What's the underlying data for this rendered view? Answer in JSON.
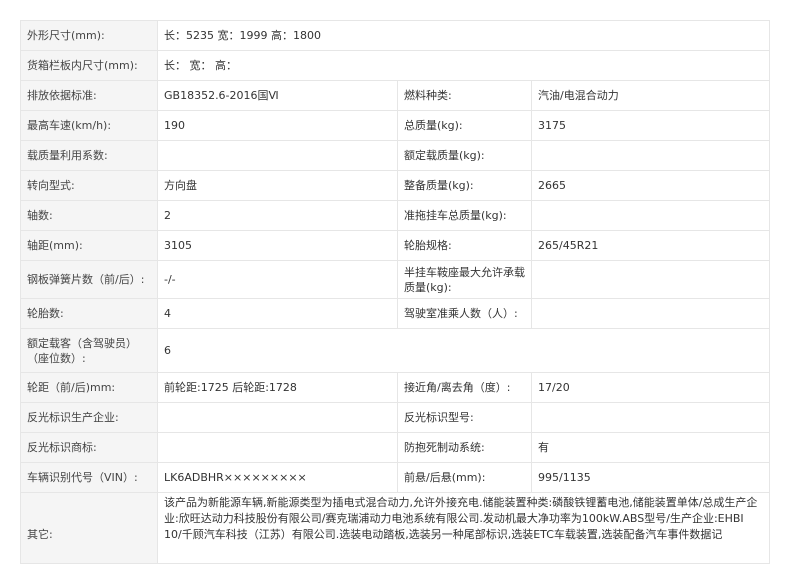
{
  "rows": [
    {
      "label": "外形尺寸(mm):",
      "value": "长：5235 宽：1999 高：1800"
    },
    {
      "label": "货箱栏板内尺寸(mm):",
      "value": "长： 宽： 高："
    },
    {
      "label": "排放依据标准:",
      "value": "GB18352.6-2016国Ⅵ",
      "label2": "燃料种类:",
      "value2": "汽油/电混合动力"
    },
    {
      "label": "最高车速(km/h):",
      "value": "190",
      "label2": "总质量(kg):",
      "value2": "3175"
    },
    {
      "label": "载质量利用系数:",
      "value": "",
      "label2": "额定载质量(kg):",
      "value2": ""
    },
    {
      "label": "转向型式:",
      "value": "方向盘",
      "label2": "整备质量(kg):",
      "value2": "2665"
    },
    {
      "label": "轴数:",
      "value": "2",
      "label2": "准拖挂车总质量(kg):",
      "value2": ""
    },
    {
      "label": "轴距(mm):",
      "value": "3105",
      "label2": "轮胎规格:",
      "value2": "265/45R21"
    },
    {
      "label": "钢板弹簧片数（前/后）:",
      "value": "-/-",
      "label2": "半挂车鞍座最大允许承载质量(kg):",
      "value2": ""
    },
    {
      "label": "轮胎数:",
      "value": "4",
      "label2": "驾驶室准乘人数（人）:",
      "value2": ""
    },
    {
      "label": "额定载客（含驾驶员）（座位数）:",
      "value": "6"
    },
    {
      "label": "轮距（前/后)mm:",
      "value": "前轮距:1725 后轮距:1728",
      "label2": "接近角/离去角（度）:",
      "value2": "17/20"
    },
    {
      "label": "反光标识生产企业:",
      "value": "",
      "label2": "反光标识型号:",
      "value2": ""
    },
    {
      "label": "反光标识商标:",
      "value": "",
      "label2": "防抱死制动系统:",
      "value2": "有"
    },
    {
      "label": "车辆识别代号（VIN）:",
      "value": "LK6ADBHR×××××××××",
      "label2": "前悬/后悬(mm):",
      "value2": "995/1135"
    },
    {
      "label": "其它:",
      "value": "该产品为新能源车辆,新能源类型为插电式混合动力,允许外接充电.储能装置种类:磷酸铁锂蓄电池,储能装置单体/总成生产企业:欣旺达动力科技股份有限公司/赛克瑞浦动力电池系统有限公司.发动机最大净功率为100kW.ABS型号/生产企业:EHBI 10/千顾汽车科技（江苏）有限公司.选装电动踏板,选装另一种尾部标识,选装ETC车载装置,选装配备汽车事件数据记"
    }
  ]
}
